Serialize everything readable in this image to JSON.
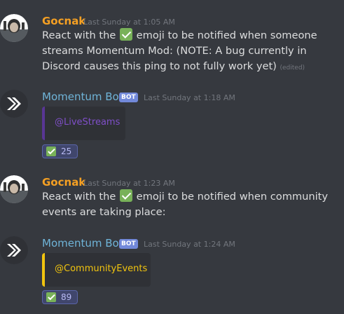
{
  "messages": [
    {
      "author": "Gocnak",
      "author_color": "#f5a023",
      "timestamp": "Last Sunday at 1:05 AM",
      "text_before": "React with the",
      "emoji": "white-check-mark",
      "text_after": "emoji to be notified when someone streams Momentum Mod: (NOTE: A bug currently in Discord causes this ping to not fully work yet)",
      "edited_label": "(edited)"
    },
    {
      "author": "Momentum Bot",
      "author_color": "#6fb4d8",
      "badge": "BOT",
      "timestamp": "Last Sunday at 1:18 AM",
      "embed_mention": "@LiveStreams",
      "embed_bar_color": "#593695",
      "reaction_emoji": "white-check-mark",
      "reaction_count": "25"
    },
    {
      "author": "Gocnak",
      "author_color": "#f5a023",
      "timestamp": "Last Sunday at 1:23 AM",
      "text_before": "React with the",
      "emoji": "white-check-mark",
      "text_after": "emoji to be notified when community events are taking place:"
    },
    {
      "author": "Momentum Bot",
      "author_color": "#6fb4d8",
      "badge": "BOT",
      "timestamp": "Last Sunday at 1:24 AM",
      "embed_mention": "@CommunityEvents",
      "embed_bar_color": "#f1c40f",
      "reaction_emoji": "white-check-mark",
      "reaction_count": "89"
    }
  ]
}
